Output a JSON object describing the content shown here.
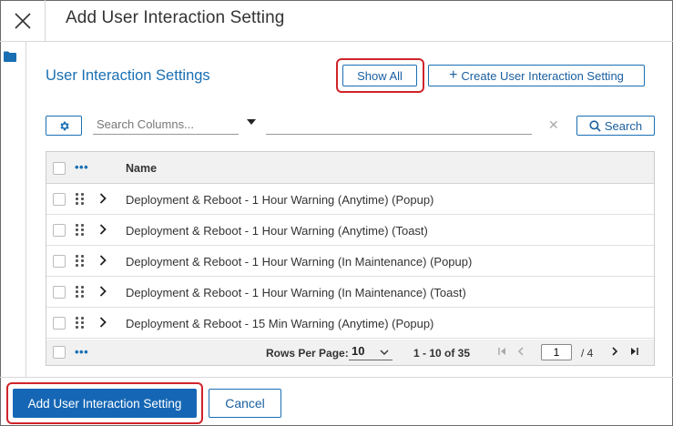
{
  "dialog": {
    "title": "Add User Interaction Setting",
    "close_icon": "close-icon"
  },
  "left_rail": {
    "icon": "folder-icon"
  },
  "panel": {
    "title": "User Interaction Settings",
    "show_all_label": "Show All",
    "create_label": "Create User Interaction Setting",
    "create_icon": "plus-icon"
  },
  "toolbar": {
    "settings_icon": "gear-icon",
    "search_columns_placeholder": "Search Columns...",
    "dropdown_icon": "caret-down-icon",
    "search_value": "",
    "clear_icon": "close-icon",
    "search_label": "Search",
    "search_icon": "magnifier-icon"
  },
  "table": {
    "header": {
      "more": "•••",
      "name": "Name"
    },
    "rows": [
      {
        "name": "Deployment & Reboot - 1 Hour Warning (Anytime) (Popup)"
      },
      {
        "name": "Deployment & Reboot - 1 Hour Warning (Anytime) (Toast)"
      },
      {
        "name": "Deployment & Reboot - 1 Hour Warning (In Maintenance) (Popup)"
      },
      {
        "name": "Deployment & Reboot - 1 Hour Warning (In Maintenance) (Toast)"
      },
      {
        "name": "Deployment & Reboot - 15 Min Warning (Anytime) (Popup)"
      }
    ],
    "footer": {
      "more": "•••",
      "rows_per_page_label": "Rows Per Page:",
      "rows_per_page_value": "10",
      "range": "1 - 10 of 35",
      "current_page": "1",
      "total_pages": "/ 4"
    }
  },
  "actions": {
    "primary_label": "Add User Interaction Setting",
    "cancel_label": "Cancel"
  },
  "colors": {
    "accent": "#1a6fb3",
    "primary_button": "#1567b5",
    "highlight": "#d0242a"
  }
}
